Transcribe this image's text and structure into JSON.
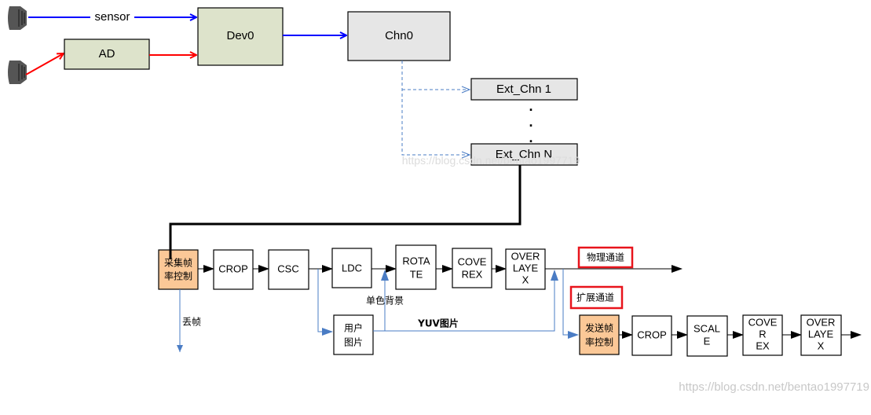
{
  "top": {
    "sensor_label": "sensor",
    "ad_label": "AD",
    "dev_label": "Dev0",
    "chn_label": "Chn0",
    "ext_chn_1": "Ext_Chn 1",
    "ext_chn_n": "Ext_Chn N",
    "ellipsis": [
      ".",
      ".",
      "."
    ]
  },
  "physical_path": {
    "title": "物理通道",
    "capture_rate": [
      "采集帧",
      "率控制"
    ],
    "crop": "CROP",
    "csc": "CSC",
    "ldc": "LDC",
    "rotate": [
      "ROTA",
      "TE"
    ],
    "coverex": [
      "COVE",
      "REX"
    ],
    "overlayex": [
      "OVER",
      "LAYE",
      "X"
    ],
    "drop_frame": "丢帧",
    "user_picture": [
      "用户",
      "图片"
    ],
    "solid_background": "单色背景",
    "yuv_picture": "YUV图片"
  },
  "extended_path": {
    "title": "扩展通道",
    "send_rate": [
      "发送帧",
      "率控制"
    ],
    "crop": "CROP",
    "scale": [
      "SCAL",
      "E"
    ],
    "coverex": [
      "COVE",
      "R",
      "EX"
    ],
    "overlayex": [
      "OVER",
      "LAYE",
      "X"
    ]
  },
  "watermark": "https://blog.csdn.net/bentao1997719",
  "colors": {
    "sensor_line": "#0000ff",
    "ad_line": "#ff0000",
    "dev_fill": "#dde3cb",
    "chn_fill": "#e6e6e6",
    "rate_fill": "#fbc897",
    "flow_blue": "#4a7cc4",
    "label_border": "#e8141c"
  }
}
